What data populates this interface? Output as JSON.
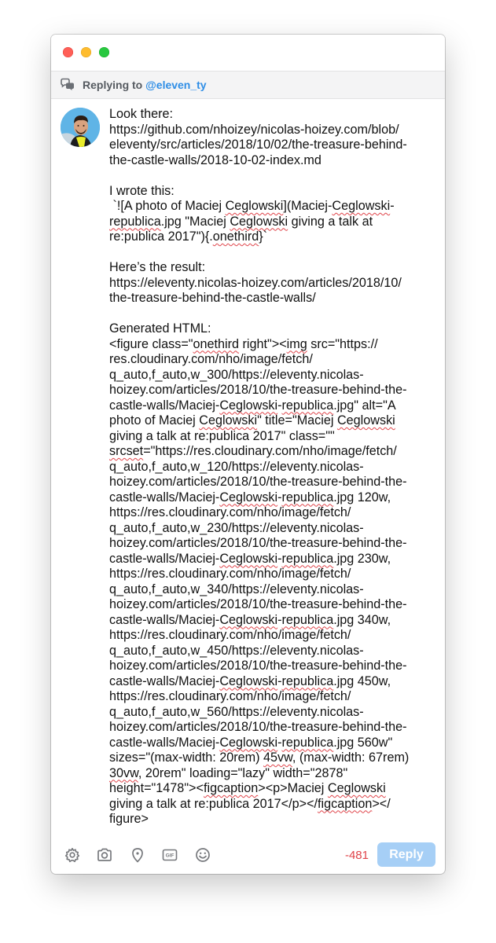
{
  "reply_bar": {
    "prefix": "Replying to ",
    "handle": "@eleven_ty",
    "icon": "conversation-icon"
  },
  "avatar": {
    "icon": "user-avatar"
  },
  "compose": {
    "text_lines": [
      "Look there:",
      "https://github.com/nhoizey/nicolas-hoizey.com/blob/",
      "eleventy/src/articles/2018/10/02/the-treasure-behind-",
      "the-castle-walls/2018-10-02-index.md",
      "",
      "I wrote this:",
      " `![A photo of Maciej Ceglowski](Maciej-Ceglowski-",
      "republica.jpg \"Maciej Ceglowski giving a talk at",
      "re:publica 2017\"){.onethird}`",
      "",
      "Here’s the result:",
      "https://eleventy.nicolas-hoizey.com/articles/2018/10/",
      "the-treasure-behind-the-castle-walls/",
      "",
      "Generated HTML:",
      "<figure class=\"onethird right\"><img src=\"https://",
      "res.cloudinary.com/nho/image/fetch/",
      "q_auto,f_auto,w_300/https://eleventy.nicolas-",
      "hoizey.com/articles/2018/10/the-treasure-behind-the-",
      "castle-walls/Maciej-Ceglowski-republica.jpg\" alt=\"A",
      "photo of Maciej Ceglowski\" title=\"Maciej Ceglowski",
      "giving a talk at re:publica 2017\" class=\"\"",
      "srcset=\"https://res.cloudinary.com/nho/image/fetch/",
      "q_auto,f_auto,w_120/https://eleventy.nicolas-",
      "hoizey.com/articles/2018/10/the-treasure-behind-the-",
      "castle-walls/Maciej-Ceglowski-republica.jpg 120w,",
      "https://res.cloudinary.com/nho/image/fetch/",
      "q_auto,f_auto,w_230/https://eleventy.nicolas-",
      "hoizey.com/articles/2018/10/the-treasure-behind-the-",
      "castle-walls/Maciej-Ceglowski-republica.jpg 230w,",
      "https://res.cloudinary.com/nho/image/fetch/",
      "q_auto,f_auto,w_340/https://eleventy.nicolas-",
      "hoizey.com/articles/2018/10/the-treasure-behind-the-",
      "castle-walls/Maciej-Ceglowski-republica.jpg 340w,",
      "https://res.cloudinary.com/nho/image/fetch/",
      "q_auto,f_auto,w_450/https://eleventy.nicolas-",
      "hoizey.com/articles/2018/10/the-treasure-behind-the-",
      "castle-walls/Maciej-Ceglowski-republica.jpg 450w,",
      "https://res.cloudinary.com/nho/image/fetch/",
      "q_auto,f_auto,w_560/https://eleventy.nicolas-",
      "hoizey.com/articles/2018/10/the-treasure-behind-the-",
      "castle-walls/Maciej-Ceglowski-republica.jpg 560w\"",
      "sizes=\"(max-width: 20rem) 45vw, (max-width: 67rem)",
      "30vw, 20rem\" loading=\"lazy\" width=\"2878\"",
      "height=\"1478\"><figcaption><p>Maciej Ceglowski",
      "giving a talk at re:publica 2017</p></figcaption></",
      "figure>"
    ],
    "misspelled_words": [
      "Ceglowski",
      "Ceglowski-",
      "republica",
      "republica.jpg",
      "re:publica",
      "onethird",
      "img",
      "srcset",
      "vw",
      "figcaption",
      "45vw",
      "30vw"
    ]
  },
  "toolbar": {
    "icons": [
      "settings-icon",
      "camera-icon",
      "location-icon",
      "gif-icon",
      "emoji-icon"
    ],
    "gif_label": "GIF",
    "char_count": "-481",
    "reply_label": "Reply"
  },
  "colors": {
    "accent": "#2f8ee6",
    "reply_button_disabled": "#a6cff6",
    "counter_negative": "#e0444a",
    "reply_bar_bg": "#f4f4f5"
  }
}
